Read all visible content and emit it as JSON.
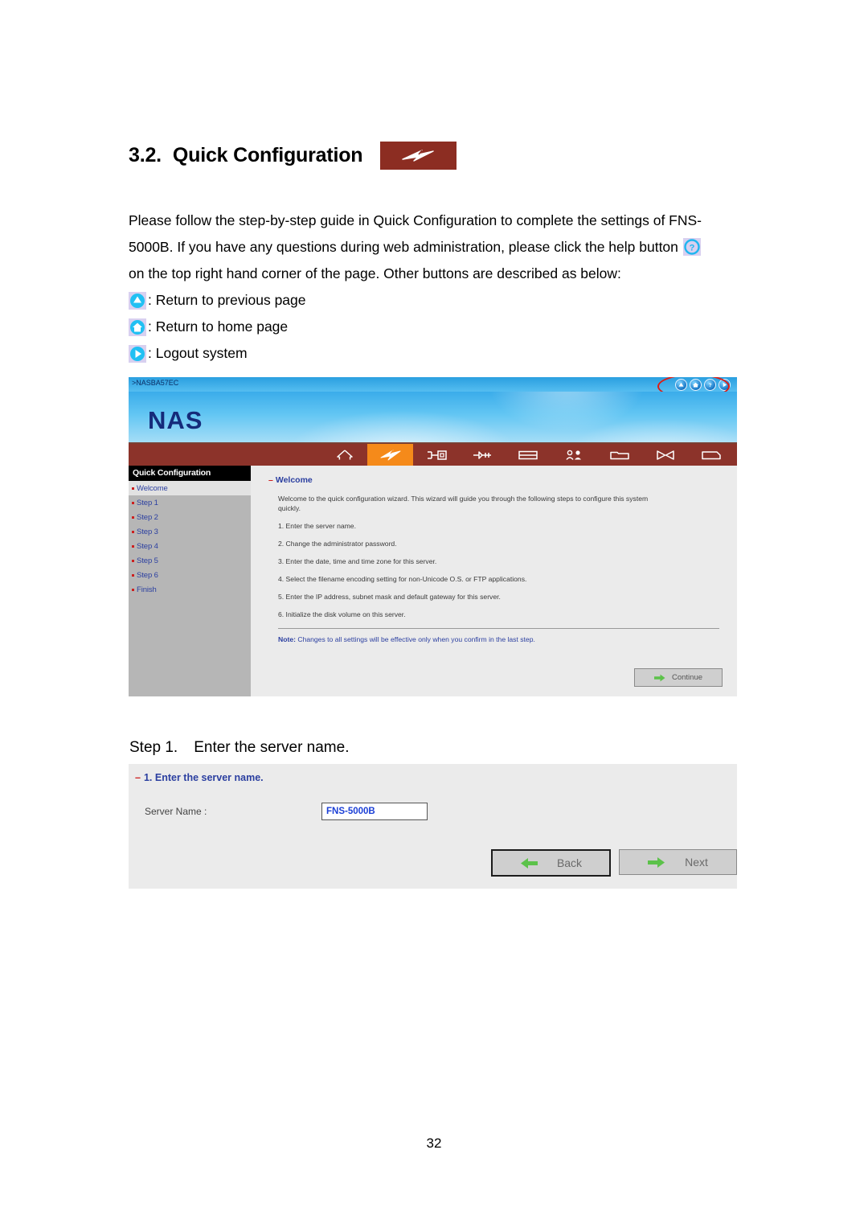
{
  "document": {
    "section_number": "3.2.",
    "section_title": "Quick Configuration",
    "section_icon": "lightning-bolt-icon",
    "paragraph_1": "Please follow the step-by-step guide in Quick Configuration to complete the settings of FNS-5000B.  If you have any questions during web administration, please click the help button",
    "paragraph_2": "on the top right hand corner of the page.  Other buttons are described as below:",
    "legend": [
      {
        "icon": "up-arrow-circle-icon",
        "text": ": Return to previous page"
      },
      {
        "icon": "home-circle-icon",
        "text": ": Return to home page"
      },
      {
        "icon": "play-circle-icon",
        "text": ": Logout system"
      }
    ],
    "help_icon": "question-circle-icon",
    "page_number": "32",
    "step_caption_label": "Step 1.",
    "step_caption_text": "Enter the server name."
  },
  "app": {
    "breadcrumb": ">NASBA57EC",
    "logo": "NAS",
    "nav_buttons": [
      {
        "name": "return-previous",
        "glyph": "▲"
      },
      {
        "name": "home",
        "glyph": "⌂"
      },
      {
        "name": "help",
        "glyph": "?"
      },
      {
        "name": "logout",
        "glyph": "▶"
      }
    ],
    "toolbar": [
      {
        "name": "home-icon",
        "active": false
      },
      {
        "name": "lightning-quick-config-icon",
        "active": true
      },
      {
        "name": "network-settings-icon",
        "active": false
      },
      {
        "name": "disk-connector-icon",
        "active": false
      },
      {
        "name": "disk-volume-icon",
        "active": false
      },
      {
        "name": "users-icon",
        "active": false
      },
      {
        "name": "folder-icon",
        "active": false
      },
      {
        "name": "network-valve-icon",
        "active": false
      },
      {
        "name": "log-document-icon",
        "active": false
      }
    ],
    "sidebar": {
      "header": "Quick Configuration",
      "items": [
        {
          "label": "Welcome",
          "selected": true
        },
        {
          "label": "Step 1",
          "selected": false
        },
        {
          "label": "Step 2",
          "selected": false
        },
        {
          "label": "Step 3",
          "selected": false
        },
        {
          "label": "Step 4",
          "selected": false
        },
        {
          "label": "Step 5",
          "selected": false
        },
        {
          "label": "Step 6",
          "selected": false
        },
        {
          "label": "Finish",
          "selected": false
        }
      ]
    },
    "content": {
      "title": "Welcome",
      "intro": "Welcome to the quick configuration wizard. This wizard will guide you through the following steps to configure this system quickly.",
      "steps": [
        "1. Enter the server name.",
        "2. Change the administrator password.",
        "3. Enter the date, time and time zone for this server.",
        "4. Select the filename encoding setting for non-Unicode O.S. or FTP applications.",
        "5. Enter the IP address, subnet mask and default gateway for this server.",
        "6. Initialize the disk volume on this server."
      ],
      "note_label": "Note:",
      "note_text": " Changes to all settings will be effective only when you confirm in the last step.",
      "continue_button": "Continue"
    }
  },
  "step_panel": {
    "title": "1. Enter the server name.",
    "field_label": "Server Name :",
    "field_value": "FNS-5000B",
    "back_button": "Back",
    "next_button": "Next"
  },
  "colors": {
    "accent_red": "#8c2d22",
    "toolbar_active": "#f58a1a",
    "link_blue": "#2b3fa0",
    "bullet_red": "#cc1f1f",
    "logo_navy": "#152b7a",
    "highlight_ellipse": "#e01b12"
  }
}
